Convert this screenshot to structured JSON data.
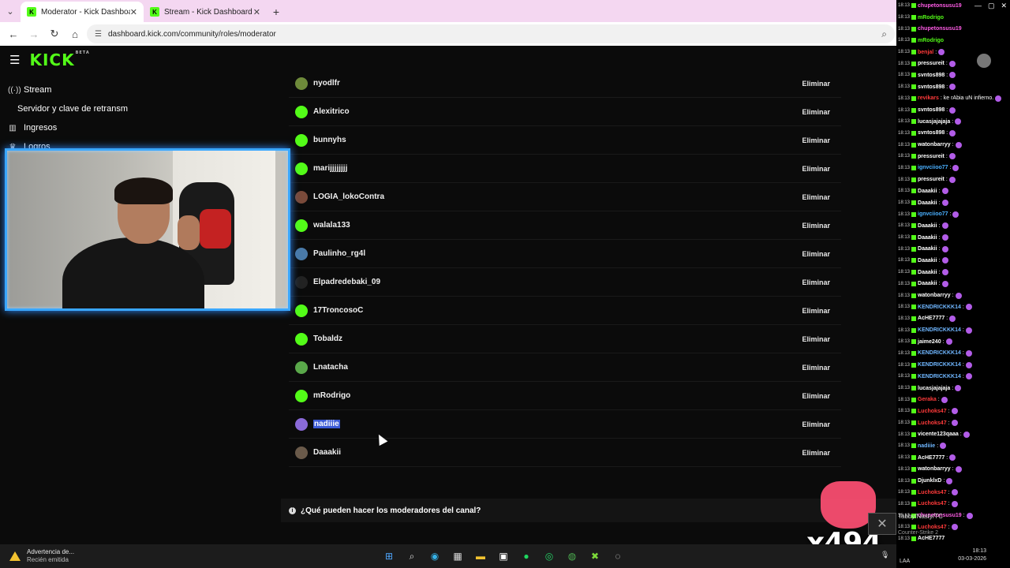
{
  "browser": {
    "tabs": [
      {
        "title": "Moderator - Kick Dashboard",
        "active": true
      },
      {
        "title": "Stream - Kick Dashboard",
        "active": false
      }
    ],
    "url": "dashboard.kick.com/community/roles/moderator"
  },
  "app": {
    "logo": "KICK",
    "logo_badge": "BETA",
    "sidebar": [
      {
        "label": "Stream",
        "icon": "broadcast-icon",
        "sub": false
      },
      {
        "label": "Servidor y clave de retransm",
        "icon": "",
        "sub": true
      },
      {
        "label": "Ingresos",
        "icon": "chart-icon",
        "sub": false
      },
      {
        "label": "Logros",
        "icon": "trophy-icon",
        "sub": false
      }
    ]
  },
  "moderators": {
    "remove_label": "Eliminar",
    "list": [
      {
        "name": "nyodlfr",
        "color": "#6e8a3a"
      },
      {
        "name": "Alexitrico",
        "color": "#53fc18"
      },
      {
        "name": "bunnyhs",
        "color": "#53fc18"
      },
      {
        "name": "marijjjjjjjj",
        "color": "#53fc18"
      },
      {
        "name": "LOGIA_lokoContra",
        "color": "#7a4a3a"
      },
      {
        "name": "walala133",
        "color": "#53fc18"
      },
      {
        "name": "Paulinho_rg4l",
        "color": "#4a7aa8"
      },
      {
        "name": "Elpadredebaki_09",
        "color": "#222222"
      },
      {
        "name": "17TroncosoC",
        "color": "#53fc18"
      },
      {
        "name": "Tobaldz",
        "color": "#53fc18"
      },
      {
        "name": "Lnatacha",
        "color": "#5aa84a"
      },
      {
        "name": "mRodrigo",
        "color": "#53fc18"
      },
      {
        "name": "nadiiie",
        "color": "#8a6ad8",
        "selected": true
      },
      {
        "name": "Daaakii",
        "color": "#6a5a4a"
      }
    ],
    "faq": "¿Qué pueden hacer los moderadores del canal?"
  },
  "overlay": {
    "cheer_count": "x494",
    "game_label": "Tabby/Nasty/TC",
    "game_sub": "Counter-Strike 2"
  },
  "chat": {
    "lines": [
      {
        "time": "18:13",
        "user": "chupetonsusu19",
        "color": "#ff5ce6",
        "msg": ""
      },
      {
        "time": "18:13",
        "user": "mRodrigo",
        "color": "#53fc18",
        "msg": ""
      },
      {
        "time": "18:13",
        "user": "chupetonsusu19",
        "color": "#ff5ce6",
        "msg": ""
      },
      {
        "time": "18:13",
        "user": "mRodrigo",
        "color": "#53fc18",
        "msg": ""
      },
      {
        "time": "18:13",
        "user": "benjal",
        "color": "#ff3a3a",
        "msg": ":"
      },
      {
        "time": "18:13",
        "user": "pressureit",
        "color": "#ffffff",
        "msg": ":"
      },
      {
        "time": "18:13",
        "user": "svntos898",
        "color": "#ffffff",
        "msg": ":"
      },
      {
        "time": "18:13",
        "user": "svntos898",
        "color": "#ffffff",
        "msg": ":"
      },
      {
        "time": "18:13",
        "user": "revikars",
        "color": "#ff3a3a",
        "msg": ": ke rAbia uN infierno."
      },
      {
        "time": "18:13",
        "user": "svntos898",
        "color": "#ffffff",
        "msg": ":"
      },
      {
        "time": "18:13",
        "user": "lucasjajajaja",
        "color": "#ffffff",
        "msg": ":"
      },
      {
        "time": "18:13",
        "user": "svntos898",
        "color": "#ffffff",
        "msg": ":"
      },
      {
        "time": "18:13",
        "user": "watonbarryy",
        "color": "#ffffff",
        "msg": ":"
      },
      {
        "time": "18:13",
        "user": "pressureit",
        "color": "#ffffff",
        "msg": ":"
      },
      {
        "time": "18:13",
        "user": "ignvciioo77",
        "color": "#4ab0ff",
        "msg": ":"
      },
      {
        "time": "18:13",
        "user": "pressureit",
        "color": "#ffffff",
        "msg": ":"
      },
      {
        "time": "18:13",
        "user": "Daaakii",
        "color": "#ffffff",
        "msg": ":"
      },
      {
        "time": "18:13",
        "user": "Daaakii",
        "color": "#ffffff",
        "msg": ":"
      },
      {
        "time": "18:13",
        "user": "ignvciioo77",
        "color": "#4ab0ff",
        "msg": ":"
      },
      {
        "time": "18:13",
        "user": "Daaakii",
        "color": "#ffffff",
        "msg": ":"
      },
      {
        "time": "18:13",
        "user": "Daaakii",
        "color": "#ffffff",
        "msg": ":"
      },
      {
        "time": "18:13",
        "user": "Daaakii",
        "color": "#ffffff",
        "msg": ":"
      },
      {
        "time": "18:13",
        "user": "Daaakii",
        "color": "#ffffff",
        "msg": ":"
      },
      {
        "time": "18:13",
        "user": "Daaakii",
        "color": "#ffffff",
        "msg": ":"
      },
      {
        "time": "18:13",
        "user": "Daaakii",
        "color": "#ffffff",
        "msg": ":"
      },
      {
        "time": "18:13",
        "user": "watonbarryy",
        "color": "#ffffff",
        "msg": ":"
      },
      {
        "time": "18:13",
        "user": "KENDRICKKK14",
        "color": "#6fb6ff",
        "msg": ":"
      },
      {
        "time": "18:13",
        "user": "AcHE7777",
        "color": "#ffffff",
        "msg": ":"
      },
      {
        "time": "18:13",
        "user": "KENDRICKKK14",
        "color": "#6fb6ff",
        "msg": ":"
      },
      {
        "time": "18:13",
        "user": "jaime240",
        "color": "#ffffff",
        "msg": ":"
      },
      {
        "time": "18:13",
        "user": "KENDRICKKK14",
        "color": "#6fb6ff",
        "msg": ":"
      },
      {
        "time": "18:13",
        "user": "KENDRICKKK14",
        "color": "#6fb6ff",
        "msg": ":"
      },
      {
        "time": "18:13",
        "user": "KENDRICKKK14",
        "color": "#6fb6ff",
        "msg": ":"
      },
      {
        "time": "18:13",
        "user": "lucasjajajaja",
        "color": "#ffffff",
        "msg": ":"
      },
      {
        "time": "18:13",
        "user": "Geraka",
        "color": "#ff3a3a",
        "msg": ":"
      },
      {
        "time": "18:13",
        "user": "Luchoks47",
        "color": "#ff3a3a",
        "msg": ":"
      },
      {
        "time": "18:13",
        "user": "Luchoks47",
        "color": "#ff3a3a",
        "msg": ":"
      },
      {
        "time": "18:13",
        "user": "vicente123qaaa",
        "color": "#ffffff",
        "msg": ":"
      },
      {
        "time": "18:13",
        "user": "nadiiie",
        "color": "#6fb6ff",
        "msg": ":"
      },
      {
        "time": "18:13",
        "user": "AcHE7777",
        "color": "#ffffff",
        "msg": ":"
      },
      {
        "time": "18:13",
        "user": "watonbarryy",
        "color": "#ffffff",
        "msg": ":"
      },
      {
        "time": "18:13",
        "user": "DjunklxD",
        "color": "#ffffff",
        "msg": ":"
      },
      {
        "time": "18:13",
        "user": "Luchoks47",
        "color": "#ff3a3a",
        "msg": ":"
      },
      {
        "time": "18:13",
        "user": "Luchoks47",
        "color": "#ff3a3a",
        "msg": ":"
      },
      {
        "time": "18:13",
        "user": "chupetonsusu19",
        "color": "#ff5ce6",
        "msg": ":"
      },
      {
        "time": "18:13",
        "user": "Luchoks47",
        "color": "#ff3a3a",
        "msg": ":"
      },
      {
        "time": "18:13",
        "user": "AcHE7777",
        "color": "#ffffff",
        "msg": ""
      }
    ]
  },
  "taskbar": {
    "notification_title": "Advertencia de...",
    "notification_sub": "Recién emitida",
    "lang": "LAA",
    "time": "18:13",
    "date": "03-03-2026"
  }
}
